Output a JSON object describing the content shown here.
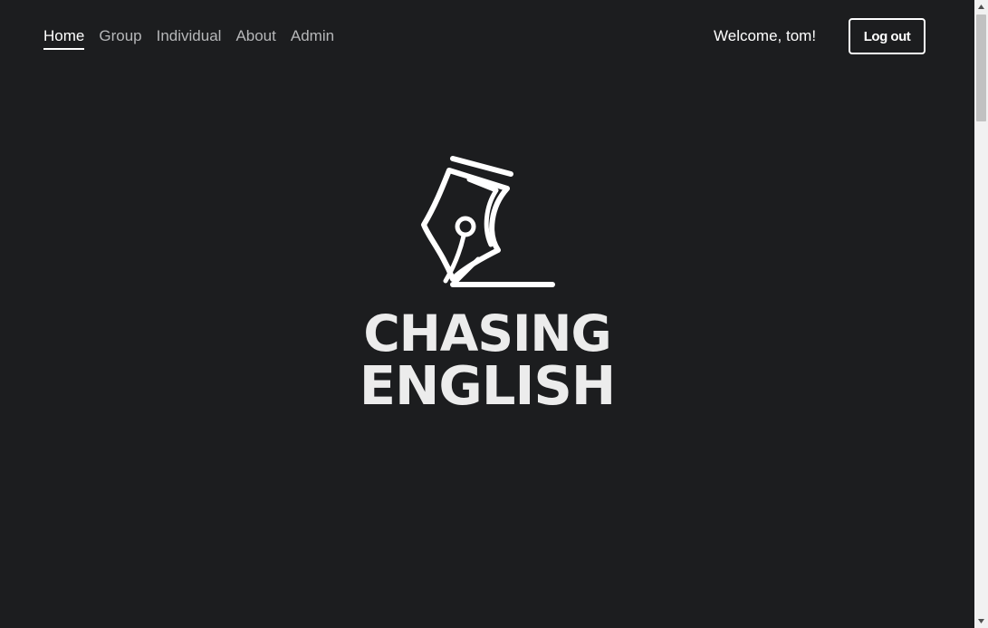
{
  "nav": {
    "items": [
      {
        "label": "Home",
        "active": true
      },
      {
        "label": "Group",
        "active": false
      },
      {
        "label": "Individual",
        "active": false
      },
      {
        "label": "About",
        "active": false
      },
      {
        "label": "Admin",
        "active": false
      }
    ]
  },
  "header": {
    "welcome_text": "Welcome, tom!",
    "logout_label": "Log out"
  },
  "hero": {
    "logo_icon": "fountain-pen-nib-icon",
    "brand_line1": "CHASING",
    "brand_line2": "ENGLISH"
  },
  "colors": {
    "background": "#1c1d1f",
    "text_primary": "#ffffff",
    "text_muted": "#b6b7b9",
    "brand_text": "#ececec"
  }
}
